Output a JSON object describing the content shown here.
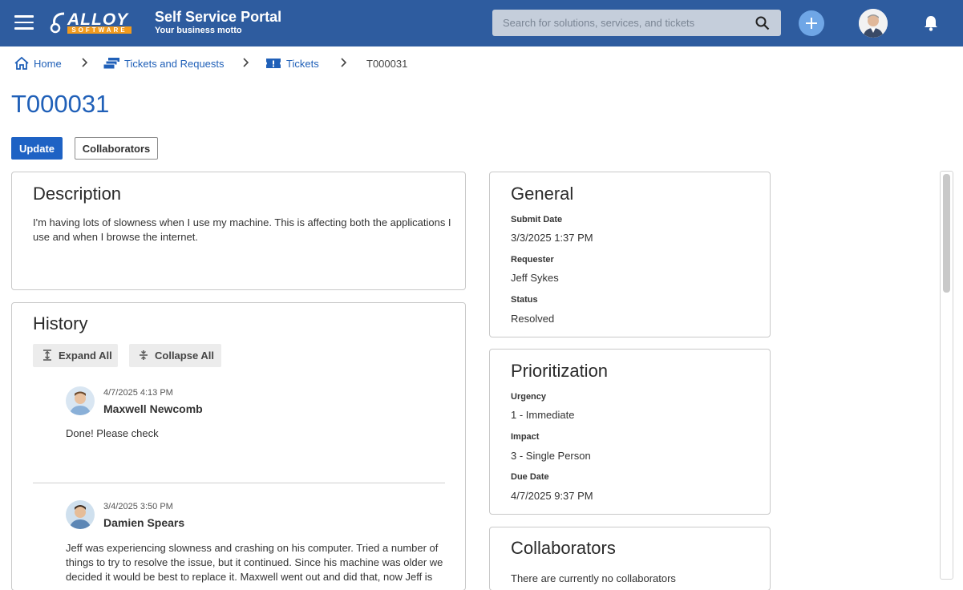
{
  "header": {
    "logo_text": "ALLOY",
    "logo_subtext": "SOFTWARE",
    "title": "Self Service Portal",
    "motto": "Your business motto",
    "search_placeholder": "Search for solutions, services, and tickets",
    "menu_icon": "hamburger-menu-icon",
    "add_icon": "plus-icon",
    "notifications_icon": "bell-icon",
    "brand_color": "#2e5c9f",
    "accent_color": "#f29b1d"
  },
  "breadcrumb": {
    "home": "Home",
    "tickets_and_requests": "Tickets and Requests",
    "tickets": "Tickets",
    "current": "T000031"
  },
  "page": {
    "title": "T000031",
    "update_label": "Update",
    "collaborators_label": "Collaborators"
  },
  "description": {
    "title": "Description",
    "line1": "I'm having lots of slowness when I use my machine. This is affecting both the applications I",
    "line2": "use and when I browse the internet."
  },
  "history": {
    "title": "History",
    "expand_all": "Expand All",
    "collapse_all": "Collapse All",
    "entries": [
      {
        "time": "4/7/2025 4:13 PM",
        "author": "Maxwell Newcomb",
        "text": "Done! Please check"
      },
      {
        "time": "3/4/2025 3:50 PM",
        "author": "Damien Spears",
        "line1": "Jeff was experiencing slowness and crashing on his computer. Tried a number of",
        "line2": "things to try to resolve the issue, but it continued. Since his machine was older we",
        "line3": "decided it would be best to replace it. Maxwell went out and did that, now Jeff is"
      }
    ]
  },
  "general": {
    "title": "General",
    "submit_date_label": "Submit Date",
    "submit_date": "3/3/2025 1:37 PM",
    "requester_label": "Requester",
    "requester": "Jeff Sykes",
    "status_label": "Status",
    "status": "Resolved"
  },
  "prioritization": {
    "title": "Prioritization",
    "urgency_label": "Urgency",
    "urgency": "1 - Immediate",
    "impact_label": "Impact",
    "impact": "3 - Single Person",
    "due_date_label": "Due Date",
    "due_date": "4/7/2025 9:37 PM"
  },
  "collaborators": {
    "title": "Collaborators",
    "empty_text": "There are currently no collaborators"
  }
}
